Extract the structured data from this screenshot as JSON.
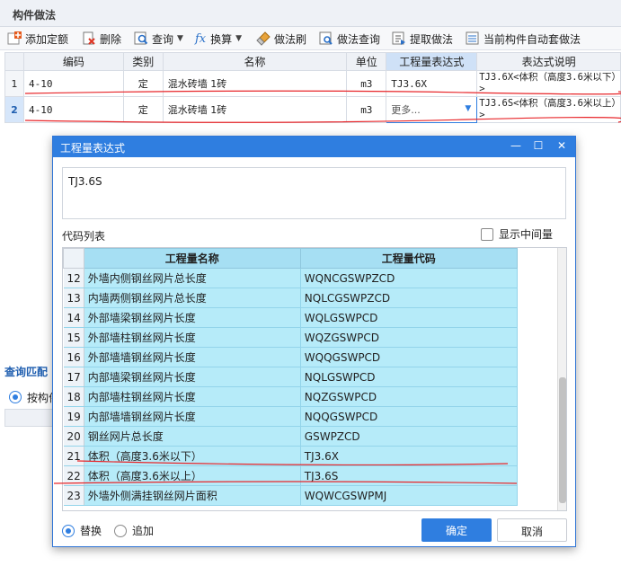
{
  "panel_title": "构件做法",
  "toolbar": {
    "add_quota": "添加定额",
    "delete": "删除",
    "query": "查询",
    "convert": "换算",
    "method_brush": "做法刷",
    "method_query": "做法查询",
    "extract_method": "提取做法",
    "auto_apply": "当前构件自动套做法"
  },
  "grid": {
    "headers": [
      "编码",
      "类别",
      "名称",
      "单位",
      "工程量表达式",
      "表达式说明"
    ],
    "rows": [
      {
        "num": "1",
        "code": "4-10",
        "category": "定",
        "name": "混水砖墙 1砖",
        "unit": "m3",
        "expr": "TJ3.6X",
        "desc": "TJ3.6X<体积（高度3.6米以下）>"
      },
      {
        "num": "2",
        "code": "4-10",
        "category": "定",
        "name": "混水砖墙 1砖",
        "unit": "m3",
        "expr": "更多...",
        "desc": "TJ3.6S<体积（高度3.6米以上）>"
      }
    ]
  },
  "lower": {
    "tab": "查询匹配",
    "radio": "按构件"
  },
  "dialog": {
    "title": "工程量表达式",
    "expression": "TJ3.6S",
    "code_list_label": "代码列表",
    "show_mid_label": "显示中间量",
    "col_name": "工程量名称",
    "col_code": "工程量代码",
    "rows": [
      {
        "num": "12",
        "name": "外墙内侧钢丝网片总长度",
        "code": "WQNCGSWPZCD"
      },
      {
        "num": "13",
        "name": "内墙两侧钢丝网片总长度",
        "code": "NQLCGSWPZCD"
      },
      {
        "num": "14",
        "name": "外部墙梁钢丝网片长度",
        "code": "WQLGSWPCD"
      },
      {
        "num": "15",
        "name": "外部墙柱钢丝网片长度",
        "code": "WQZGSWPCD"
      },
      {
        "num": "16",
        "name": "外部墙墙钢丝网片长度",
        "code": "WQQGSWPCD"
      },
      {
        "num": "17",
        "name": "内部墙梁钢丝网片长度",
        "code": "NQLGSWPCD"
      },
      {
        "num": "18",
        "name": "内部墙柱钢丝网片长度",
        "code": "NQZGSWPCD"
      },
      {
        "num": "19",
        "name": "内部墙墙钢丝网片长度",
        "code": "NQQGSWPCD"
      },
      {
        "num": "20",
        "name": "钢丝网片总长度",
        "code": "GSWPZCD"
      },
      {
        "num": "21",
        "name": "体积（高度3.6米以下）",
        "code": "TJ3.6X"
      },
      {
        "num": "22",
        "name": "体积（高度3.6米以上）",
        "code": "TJ3.6S"
      },
      {
        "num": "23",
        "name": "外墙外侧满挂钢丝网片面积",
        "code": "WQWCGSWPMJ"
      }
    ],
    "replace_label": "替换",
    "append_label": "追加",
    "ok_label": "确定",
    "cancel_label": "取消"
  },
  "colors": {
    "accent": "#2f7ee0",
    "row_cyan": "#b6ebf9",
    "annotation_red": "#e8262a"
  }
}
